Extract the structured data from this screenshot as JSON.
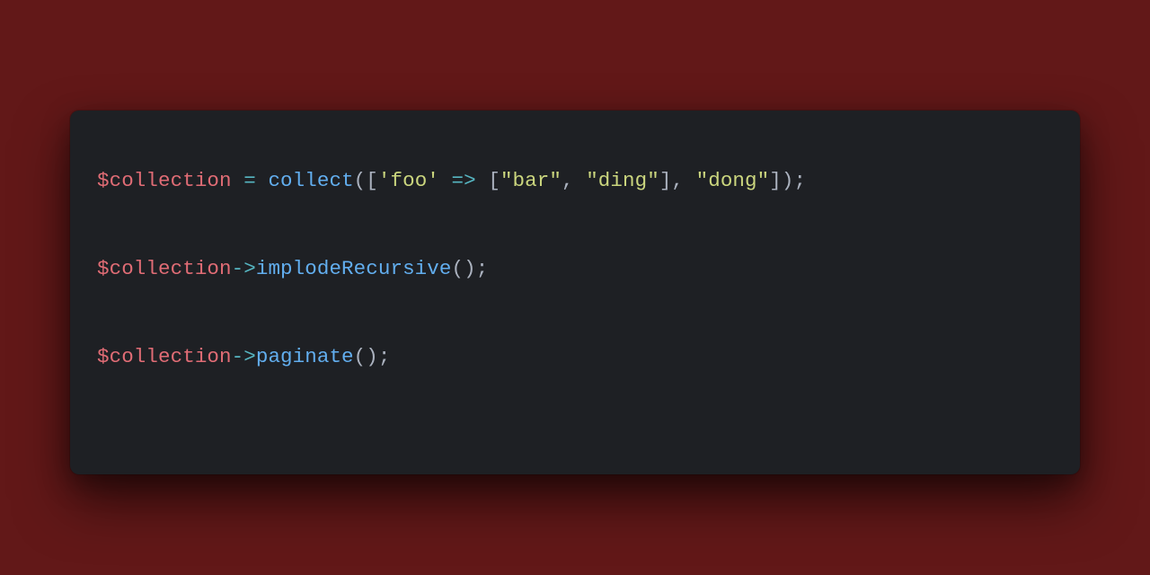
{
  "colors": {
    "background": "#621818",
    "card": "#1e2024",
    "var": "#e06c75",
    "punc": "#abb2bf",
    "op": "#56b6c2",
    "func": "#62aeef",
    "str": "#cbd67e"
  },
  "code": {
    "lines": [
      [
        {
          "t": "$collection",
          "c": "var"
        },
        {
          "t": " ",
          "c": "default"
        },
        {
          "t": "=",
          "c": "op"
        },
        {
          "t": " ",
          "c": "default"
        },
        {
          "t": "collect",
          "c": "func"
        },
        {
          "t": "([",
          "c": "punc"
        },
        {
          "t": "'foo'",
          "c": "str"
        },
        {
          "t": " ",
          "c": "default"
        },
        {
          "t": "=>",
          "c": "op"
        },
        {
          "t": " [",
          "c": "punc"
        },
        {
          "t": "\"bar\"",
          "c": "str"
        },
        {
          "t": ", ",
          "c": "punc"
        },
        {
          "t": "\"ding\"",
          "c": "str"
        },
        {
          "t": "], ",
          "c": "punc"
        },
        {
          "t": "\"dong\"",
          "c": "str"
        },
        {
          "t": "]);",
          "c": "punc"
        }
      ],
      [],
      [
        {
          "t": "$collection",
          "c": "var"
        },
        {
          "t": "->",
          "c": "op"
        },
        {
          "t": "implodeRecursive",
          "c": "func"
        },
        {
          "t": "();",
          "c": "punc"
        }
      ],
      [],
      [
        {
          "t": "$collection",
          "c": "var"
        },
        {
          "t": "->",
          "c": "op"
        },
        {
          "t": "paginate",
          "c": "func"
        },
        {
          "t": "();",
          "c": "punc"
        }
      ]
    ]
  }
}
